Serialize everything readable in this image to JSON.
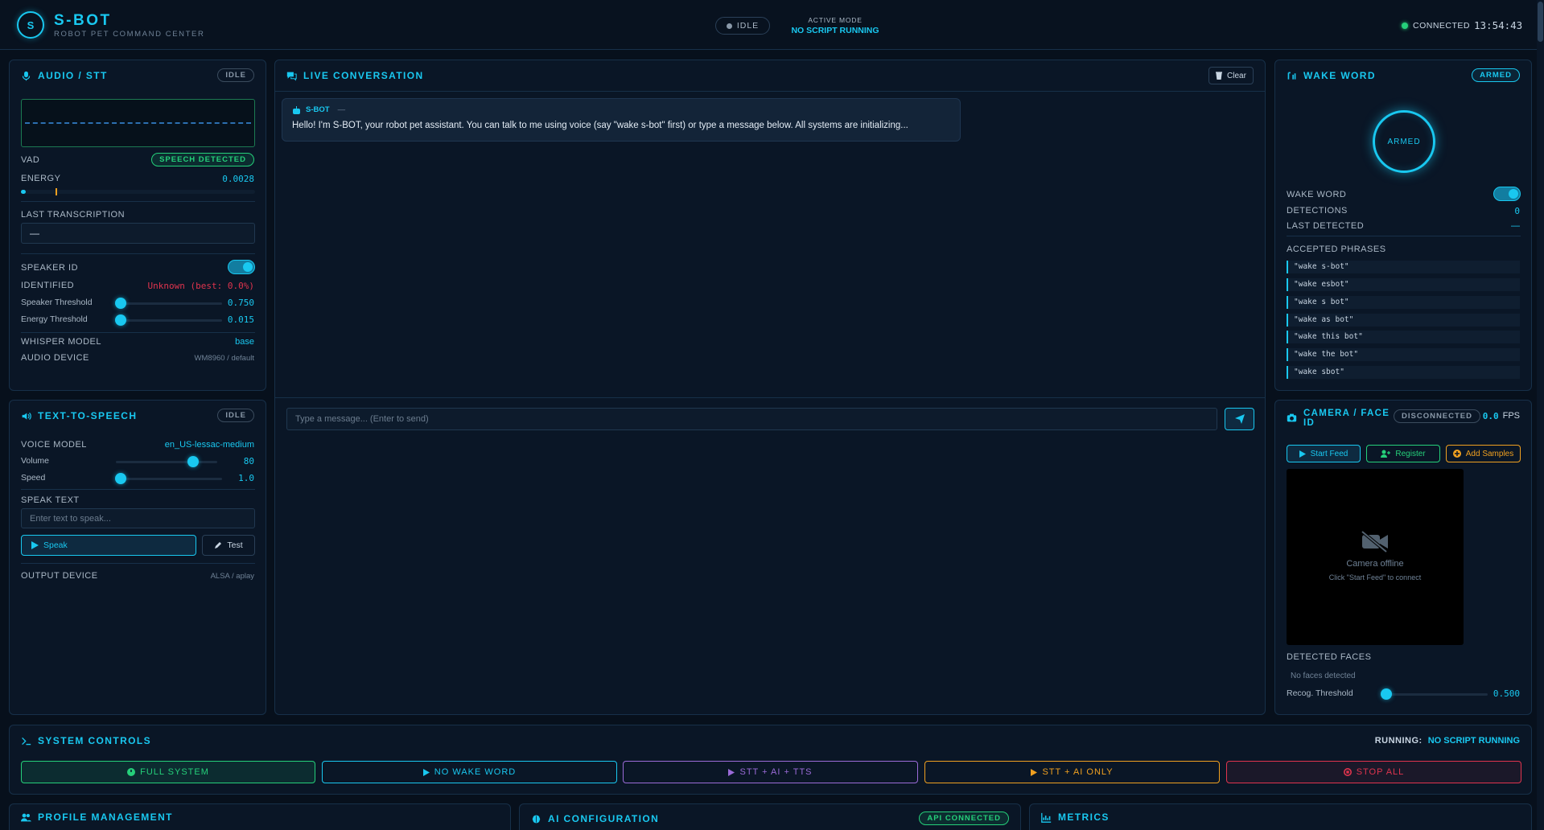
{
  "header": {
    "logo_letter": "S",
    "title": "S-BOT",
    "subtitle": "ROBOT PET COMMAND CENTER",
    "status_pill": "IDLE",
    "mode_label": "ACTIVE MODE",
    "mode_value": "NO SCRIPT RUNNING",
    "connection": "CONNECTED",
    "clock": "13:54:43"
  },
  "audio": {
    "title": "AUDIO / STT",
    "badge": "IDLE",
    "vad_label": "VAD",
    "vad_badge": "SPEECH DETECTED",
    "energy_label": "ENERGY",
    "energy_value": "0.0028",
    "energy_level": 0.02,
    "last_transcription_label": "LAST TRANSCRIPTION",
    "last_transcription_value": "—",
    "speaker_id_label": "SPEAKER ID",
    "identified_label": "IDENTIFIED",
    "identified_value": "Unknown (best: 0.0%)",
    "speaker_threshold_label": "Speaker Threshold",
    "speaker_threshold_value": "0.750",
    "speaker_threshold_pos": 0.0,
    "energy_threshold_label": "Energy Threshold",
    "energy_threshold_value": "0.015",
    "energy_threshold_pos": 0.0,
    "whisper_label": "WHISPER MODEL",
    "whisper_value": "base",
    "device_label": "AUDIO DEVICE",
    "device_value": "WM8960 / default"
  },
  "tts": {
    "title": "TEXT-TO-SPEECH",
    "badge": "IDLE",
    "voice_label": "VOICE MODEL",
    "voice_value": "en_US-lessac-medium",
    "volume_label": "Volume",
    "volume_value": "80",
    "volume_pos": 0.76,
    "speed_label": "Speed",
    "speed_value": "1.0",
    "speed_pos": 0.0,
    "speak_text_label": "SPEAK TEXT",
    "speak_placeholder": "Enter text to speak...",
    "speak_button": "Speak",
    "test_button": "Test",
    "output_label": "OUTPUT DEVICE",
    "output_value": "ALSA / aplay"
  },
  "conversation": {
    "title": "LIVE CONVERSATION",
    "clear_button": "Clear",
    "message_sender": "S-BOT",
    "message_time": "—",
    "message_text": "Hello! I'm S-BOT, your robot pet assistant. You can talk to me using voice (say \"wake s-bot\" first) or type a message below. All systems are initializing...",
    "input_placeholder": "Type a message... (Enter to send)"
  },
  "wake": {
    "title": "WAKE WORD",
    "badge": "ARMED",
    "ring_label": "ARMED",
    "wake_word_label": "WAKE WORD",
    "detections_label": "DETECTIONS",
    "detections_value": "0",
    "last_label": "LAST DETECTED",
    "last_value": "—",
    "phrases_label": "ACCEPTED PHRASES",
    "phrases": [
      "\"wake s-bot\"",
      "\"wake esbot\"",
      "\"wake s bot\"",
      "\"wake as bot\"",
      "\"wake this bot\"",
      "\"wake the bot\"",
      "\"wake sbot\""
    ]
  },
  "camera": {
    "title": "CAMERA / FACE ID",
    "badge": "DISCONNECTED",
    "fps_value": "0.0",
    "fps_unit": "FPS",
    "start_button": "Start Feed",
    "register_button": "Register",
    "add_samples_button": "Add Samples",
    "offline_text": "Camera offline",
    "offline_hint": "Click \"Start Feed\" to connect",
    "faces_label": "DETECTED FACES",
    "faces_value": "No faces detected",
    "recog_label": "Recog. Threshold",
    "recog_value": "0.500",
    "recog_pos": 0.0
  },
  "controls": {
    "title": "SYSTEM CONTROLS",
    "running_label": "RUNNING:",
    "running_value": "NO SCRIPT RUNNING",
    "buttons": [
      "FULL SYSTEM",
      "NO WAKE WORD",
      "STT + AI + TTS",
      "STT + AI ONLY",
      "STOP ALL"
    ]
  },
  "bottom": {
    "profile_title": "PROFILE MANAGEMENT",
    "ai_title": "AI CONFIGURATION",
    "ai_badge": "API CONNECTED",
    "metrics_title": "METRICS"
  },
  "colors": {
    "accent": "#19c8f0",
    "green": "#25d07a",
    "purple": "#9b6bd8",
    "orange": "#f0a020",
    "red": "#e0344e"
  }
}
